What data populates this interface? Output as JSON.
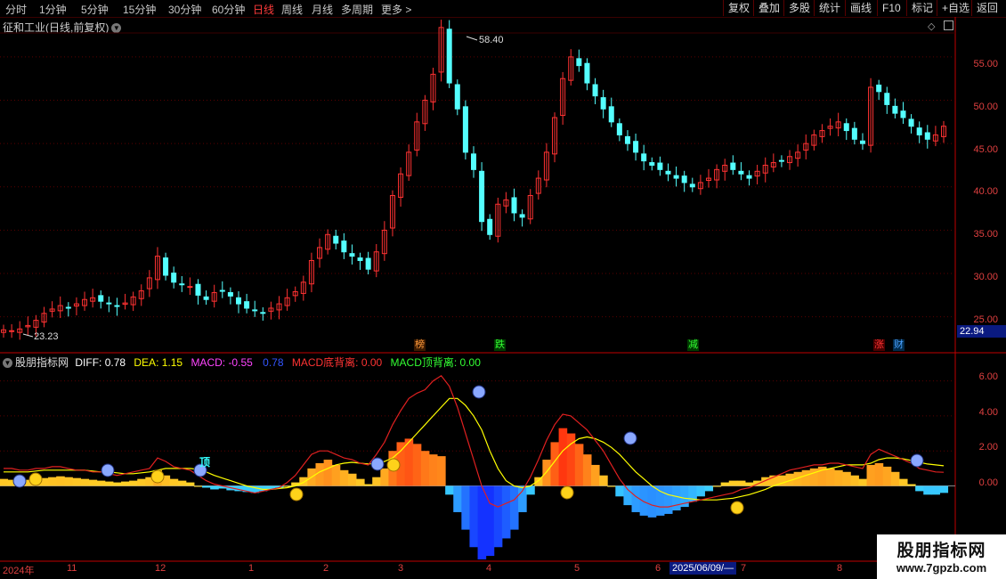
{
  "toolbar": {
    "timeframes": [
      "分时",
      "1分钟",
      "5分钟",
      "15分钟",
      "30分钟",
      "60分钟",
      "日线",
      "周线",
      "月线",
      "多周期",
      "更多 >"
    ],
    "active_timeframe": "日线",
    "right_buttons": [
      "复权",
      "叠加",
      "多股",
      "统计",
      "画线",
      "F10",
      "标记",
      "+自选",
      "返回"
    ]
  },
  "stock": {
    "title": "征和工业(日线,前复权)",
    "current_price_label": "22.94"
  },
  "price_axis": {
    "ticks": [
      "55.00",
      "50.00",
      "45.00",
      "40.00",
      "35.00",
      "30.00",
      "25.00"
    ],
    "high_label": "58.40",
    "low_label": "23.23"
  },
  "event_tags": [
    {
      "text": "榜",
      "color": "#ff9a3c"
    },
    {
      "text": "跌",
      "color": "#33ff33"
    },
    {
      "text": "减",
      "color": "#33ff33"
    },
    {
      "text": "涨",
      "color": "#ff3333"
    },
    {
      "text": "财",
      "color": "#4aa0ff"
    }
  ],
  "indicator": {
    "name": "股朋指标网",
    "diff": "DIFF: 0.78",
    "dea": "DEA: 1.15",
    "macd": "MACD: -0.55",
    "extra": "0.78",
    "bottom_div": "MACD底背离: 0.00",
    "top_div": "MACD顶背离: 0.00",
    "ticks": [
      "6.00",
      "4.00",
      "2.00",
      "0.00"
    ],
    "cross_label": "顶"
  },
  "date_axis": {
    "labels": [
      "2024年",
      "11",
      "12",
      "1",
      "2",
      "3",
      "4",
      "5",
      "6",
      "7",
      "8"
    ],
    "cursor_date": "2025/06/09/—"
  },
  "watermark": {
    "title": "股朋指标网",
    "url": "www.7gpzb.com"
  },
  "colors": {
    "up": "#ff3232",
    "down": "#54ffff",
    "diff_line": "#ffffff",
    "dea_line": "#ffff00",
    "axis": "#c00000"
  },
  "chart_data": {
    "type": "candlestick",
    "price_series_close": [
      23.5,
      23.4,
      23.6,
      24.0,
      24.6,
      25.4,
      25.9,
      26.3,
      26.0,
      26.5,
      27.0,
      27.2,
      26.8,
      26.5,
      26.2,
      26.6,
      27.3,
      28.0,
      29.5,
      32.0,
      29.8,
      29.0,
      28.7,
      28.5,
      27.5,
      27.0,
      27.8,
      28.0,
      27.4,
      26.5,
      26.0,
      25.7,
      25.4,
      26.0,
      26.5,
      27.2,
      27.9,
      29.0,
      31.5,
      33.0,
      34.5,
      33.5,
      32.5,
      32.0,
      31.5,
      30.5,
      32.5,
      35.0,
      39.0,
      41.5,
      44.0,
      47.5,
      50.0,
      53.0,
      58.4,
      52.0,
      49.0,
      44.0,
      42.0,
      36.0,
      34.5,
      38.0,
      38.5,
      37.0,
      36.5,
      39.0,
      41.0,
      44.0,
      48.0,
      52.5,
      55.0,
      54.0,
      52.0,
      50.5,
      49.0,
      47.5,
      46.0,
      45.0,
      44.0,
      43.0,
      42.5,
      42.0,
      41.5,
      41.0,
      40.5,
      40.0,
      40.5,
      41.0,
      42.0,
      42.5,
      42.0,
      41.5,
      41.0,
      41.8,
      42.5,
      42.8,
      43.0,
      43.5,
      44.0,
      45.0,
      46.0,
      46.5,
      47.0,
      47.5,
      46.5,
      45.5,
      45.0,
      51.5,
      51.0,
      49.5,
      48.5,
      48.0,
      47.0,
      46.0,
      45.5,
      46.0,
      47.0
    ],
    "macd_hist": [
      0.4,
      0.35,
      0.3,
      0.35,
      0.4,
      0.45,
      0.5,
      0.55,
      0.5,
      0.45,
      0.4,
      0.35,
      0.3,
      0.25,
      0.2,
      0.25,
      0.3,
      0.4,
      0.5,
      0.9,
      0.6,
      0.4,
      0.3,
      0.2,
      0.0,
      -0.1,
      -0.2,
      -0.15,
      -0.25,
      -0.3,
      -0.35,
      -0.4,
      -0.3,
      -0.2,
      -0.1,
      0.0,
      0.2,
      0.5,
      1.0,
      1.3,
      1.5,
      1.2,
      0.9,
      0.7,
      0.4,
      0.1,
      0.5,
      1.0,
      2.0,
      2.5,
      2.7,
      2.4,
      2.0,
      1.8,
      1.7,
      -0.5,
      -1.5,
      -2.5,
      -3.5,
      -4.2,
      -4.0,
      -3.5,
      -3.0,
      -2.5,
      -1.5,
      -0.5,
      0.5,
      1.5,
      2.5,
      3.3,
      3.0,
      2.4,
      1.8,
      1.2,
      0.6,
      0.0,
      -0.6,
      -1.1,
      -1.5,
      -1.7,
      -1.8,
      -1.7,
      -1.6,
      -1.4,
      -1.2,
      -0.9,
      -0.6,
      -0.3,
      0.0,
      0.2,
      0.3,
      0.3,
      0.2,
      0.3,
      0.5,
      0.6,
      0.6,
      0.7,
      0.8,
      0.9,
      1.0,
      1.1,
      1.0,
      0.9,
      0.8,
      0.6,
      0.4,
      1.2,
      1.3,
      1.1,
      0.8,
      0.4,
      0.1,
      -0.3,
      -0.5,
      -0.5,
      -0.4
    ],
    "diff": [
      1.0,
      1.0,
      0.9,
      0.9,
      1.0,
      1.0,
      1.1,
      1.1,
      1.0,
      0.9,
      0.9,
      0.8,
      0.8,
      0.7,
      0.6,
      0.7,
      0.8,
      0.9,
      1.0,
      1.6,
      1.4,
      1.1,
      1.0,
      0.9,
      0.6,
      0.3,
      0.1,
      0.0,
      -0.1,
      -0.2,
      -0.3,
      -0.4,
      -0.3,
      -0.2,
      -0.1,
      0.2,
      0.6,
      1.2,
      1.8,
      2.0,
      2.0,
      1.8,
      1.6,
      1.5,
      1.3,
      1.2,
      1.8,
      2.5,
      3.5,
      4.3,
      5.0,
      5.3,
      5.5,
      6.0,
      6.3,
      5.7,
      4.5,
      3.0,
      1.5,
      0.0,
      -1.0,
      -1.2,
      -1.0,
      -0.8,
      -0.3,
      0.5,
      1.5,
      2.6,
      3.5,
      4.1,
      4.0,
      3.6,
      3.2,
      2.6,
      2.0,
      1.2,
      0.4,
      -0.2,
      -0.6,
      -0.9,
      -1.1,
      -1.2,
      -1.2,
      -1.1,
      -1.0,
      -0.9,
      -0.8,
      -0.7,
      -0.6,
      -0.5,
      -0.4,
      -0.2,
      -0.1,
      0.1,
      0.3,
      0.5,
      0.7,
      0.9,
      1.0,
      1.1,
      1.2,
      1.2,
      1.3,
      1.3,
      1.2,
      1.1,
      1.0,
      1.8,
      2.1,
      1.9,
      1.7,
      1.5,
      1.3,
      1.0,
      0.9,
      0.8,
      0.78
    ],
    "dea": [
      0.8,
      0.8,
      0.8,
      0.8,
      0.85,
      0.9,
      0.9,
      0.9,
      0.9,
      0.9,
      0.9,
      0.85,
      0.8,
      0.8,
      0.75,
      0.7,
      0.7,
      0.75,
      0.8,
      0.9,
      1.0,
      1.0,
      1.0,
      1.0,
      0.95,
      0.8,
      0.6,
      0.45,
      0.3,
      0.15,
      0.0,
      -0.1,
      -0.2,
      -0.2,
      -0.15,
      -0.1,
      0.0,
      0.2,
      0.5,
      0.8,
      1.0,
      1.2,
      1.3,
      1.35,
      1.3,
      1.25,
      1.3,
      1.4,
      1.6,
      2.0,
      2.5,
      3.0,
      3.5,
      4.0,
      4.5,
      5.0,
      5.0,
      4.6,
      4.0,
      3.2,
      2.0,
      1.0,
      0.3,
      0.0,
      -0.1,
      0.0,
      0.3,
      0.8,
      1.4,
      2.0,
      2.4,
      2.7,
      2.8,
      2.7,
      2.5,
      2.2,
      1.8,
      1.3,
      0.8,
      0.4,
      0.0,
      -0.3,
      -0.5,
      -0.6,
      -0.7,
      -0.75,
      -0.8,
      -0.8,
      -0.8,
      -0.75,
      -0.7,
      -0.6,
      -0.5,
      -0.35,
      -0.2,
      0.0,
      0.15,
      0.3,
      0.45,
      0.6,
      0.75,
      0.9,
      1.0,
      1.1,
      1.2,
      1.2,
      1.2,
      1.3,
      1.5,
      1.6,
      1.6,
      1.55,
      1.45,
      1.35,
      1.25,
      1.2,
      1.15
    ]
  }
}
